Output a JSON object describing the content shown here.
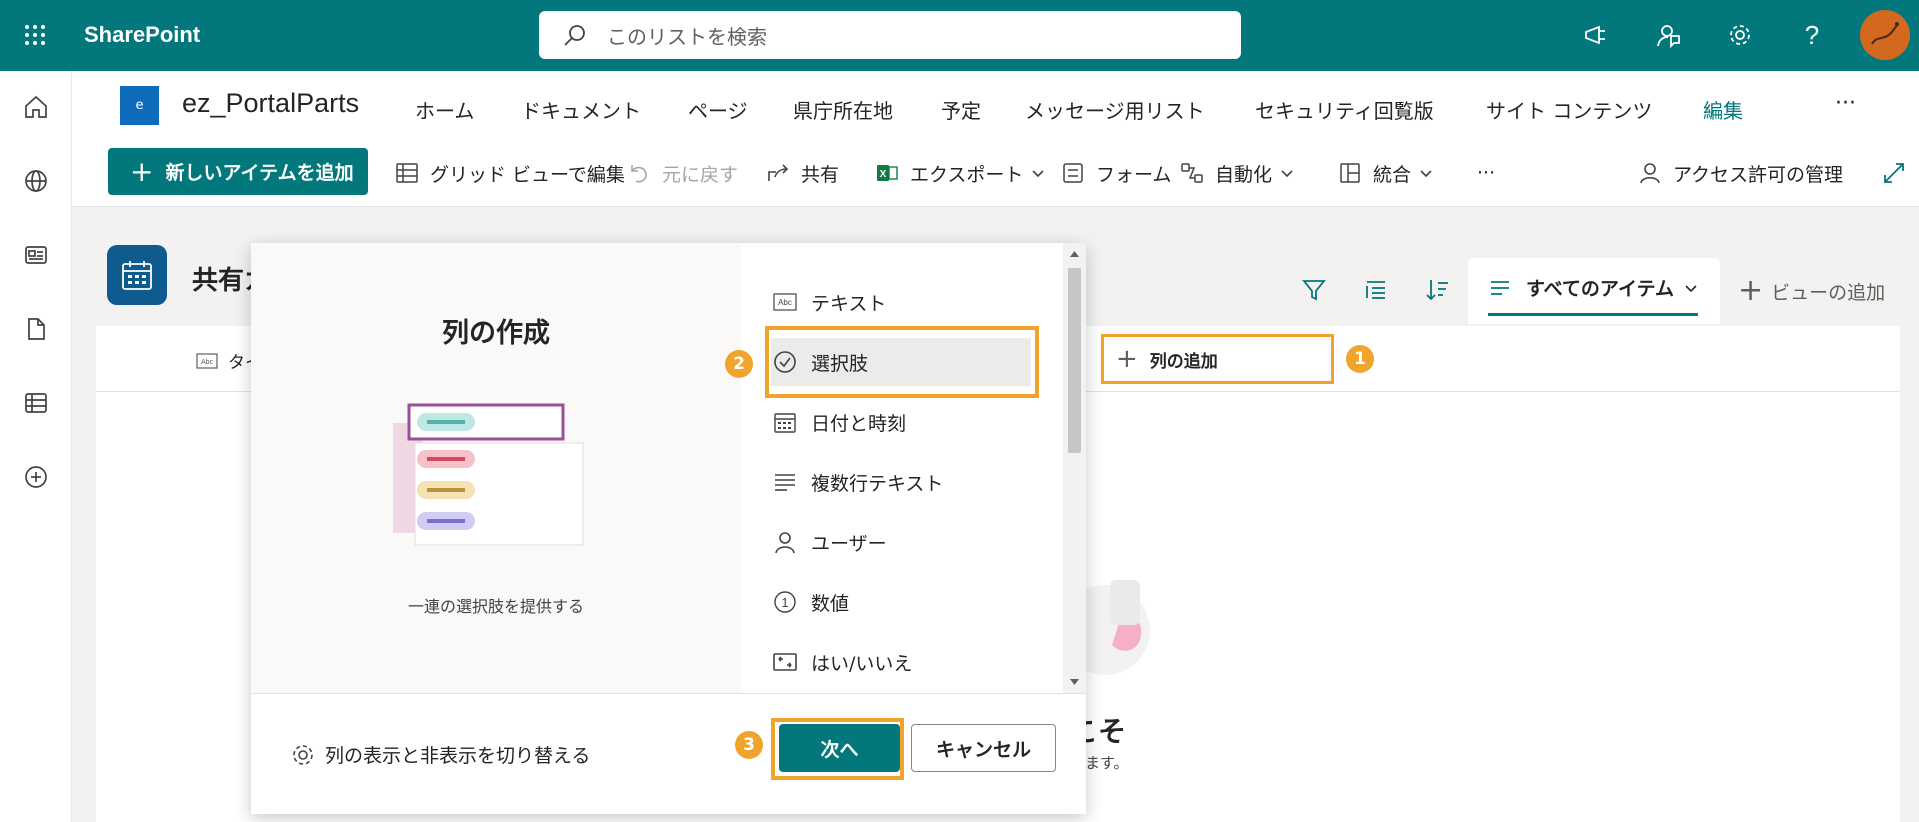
{
  "suite": {
    "brand": "SharePoint",
    "search_placeholder": "このリストを検索",
    "icons": [
      "waffle-icon",
      "megaphone-icon",
      "feedback-icon",
      "gear-icon",
      "help-icon",
      "avatar"
    ],
    "accent": "#03787c"
  },
  "left_rail": {
    "items": [
      "home-icon",
      "globe-icon",
      "news-icon",
      "document-icon",
      "list-icon",
      "add-circle-icon"
    ]
  },
  "site": {
    "logo_letter": "e",
    "title": "ez_PortalParts",
    "nav": [
      "ホーム",
      "ドキュメント",
      "ページ",
      "県庁所在地",
      "予定",
      "メッセージ用リスト",
      "セキュリティ回覧版",
      "サイト コンテンツ",
      "編集"
    ],
    "more": "···"
  },
  "command_bar": {
    "new_item": "新しいアイテムを追加",
    "grid_edit": "グリッド ビューで編集",
    "undo": "元に戻す",
    "share": "共有",
    "export": "エクスポート",
    "forms": "フォーム",
    "automate": "自動化",
    "integrate": "統合",
    "more": "···",
    "manage_access": "アクセス許可の管理"
  },
  "list": {
    "title": "共有カ",
    "view_name": "すべてのアイテム",
    "add_view": "ビューの追加",
    "column_title": "タイ",
    "add_column": "列の追加",
    "welcome_title": "こそ",
    "welcome_sub": "します。",
    "badges": [
      "1",
      "2",
      "3"
    ]
  },
  "dialog": {
    "title": "列の作成",
    "description": "一連の選択肢を提供する",
    "types": [
      {
        "label": "テキスト",
        "icon": "text-icon"
      },
      {
        "label": "選択肢",
        "icon": "choice-icon"
      },
      {
        "label": "日付と時刻",
        "icon": "calendar-icon"
      },
      {
        "label": "複数行テキスト",
        "icon": "multiline-text-icon"
      },
      {
        "label": "ユーザー",
        "icon": "person-icon"
      },
      {
        "label": "数値",
        "icon": "number-icon"
      },
      {
        "label": "はい/いいえ",
        "icon": "yes-no-icon"
      }
    ],
    "selected_index": 1,
    "toggle_columns": "列の表示と非表示を切り替える",
    "next": "次へ",
    "cancel": "キャンセル",
    "highlight_color": "#f0a42b"
  }
}
